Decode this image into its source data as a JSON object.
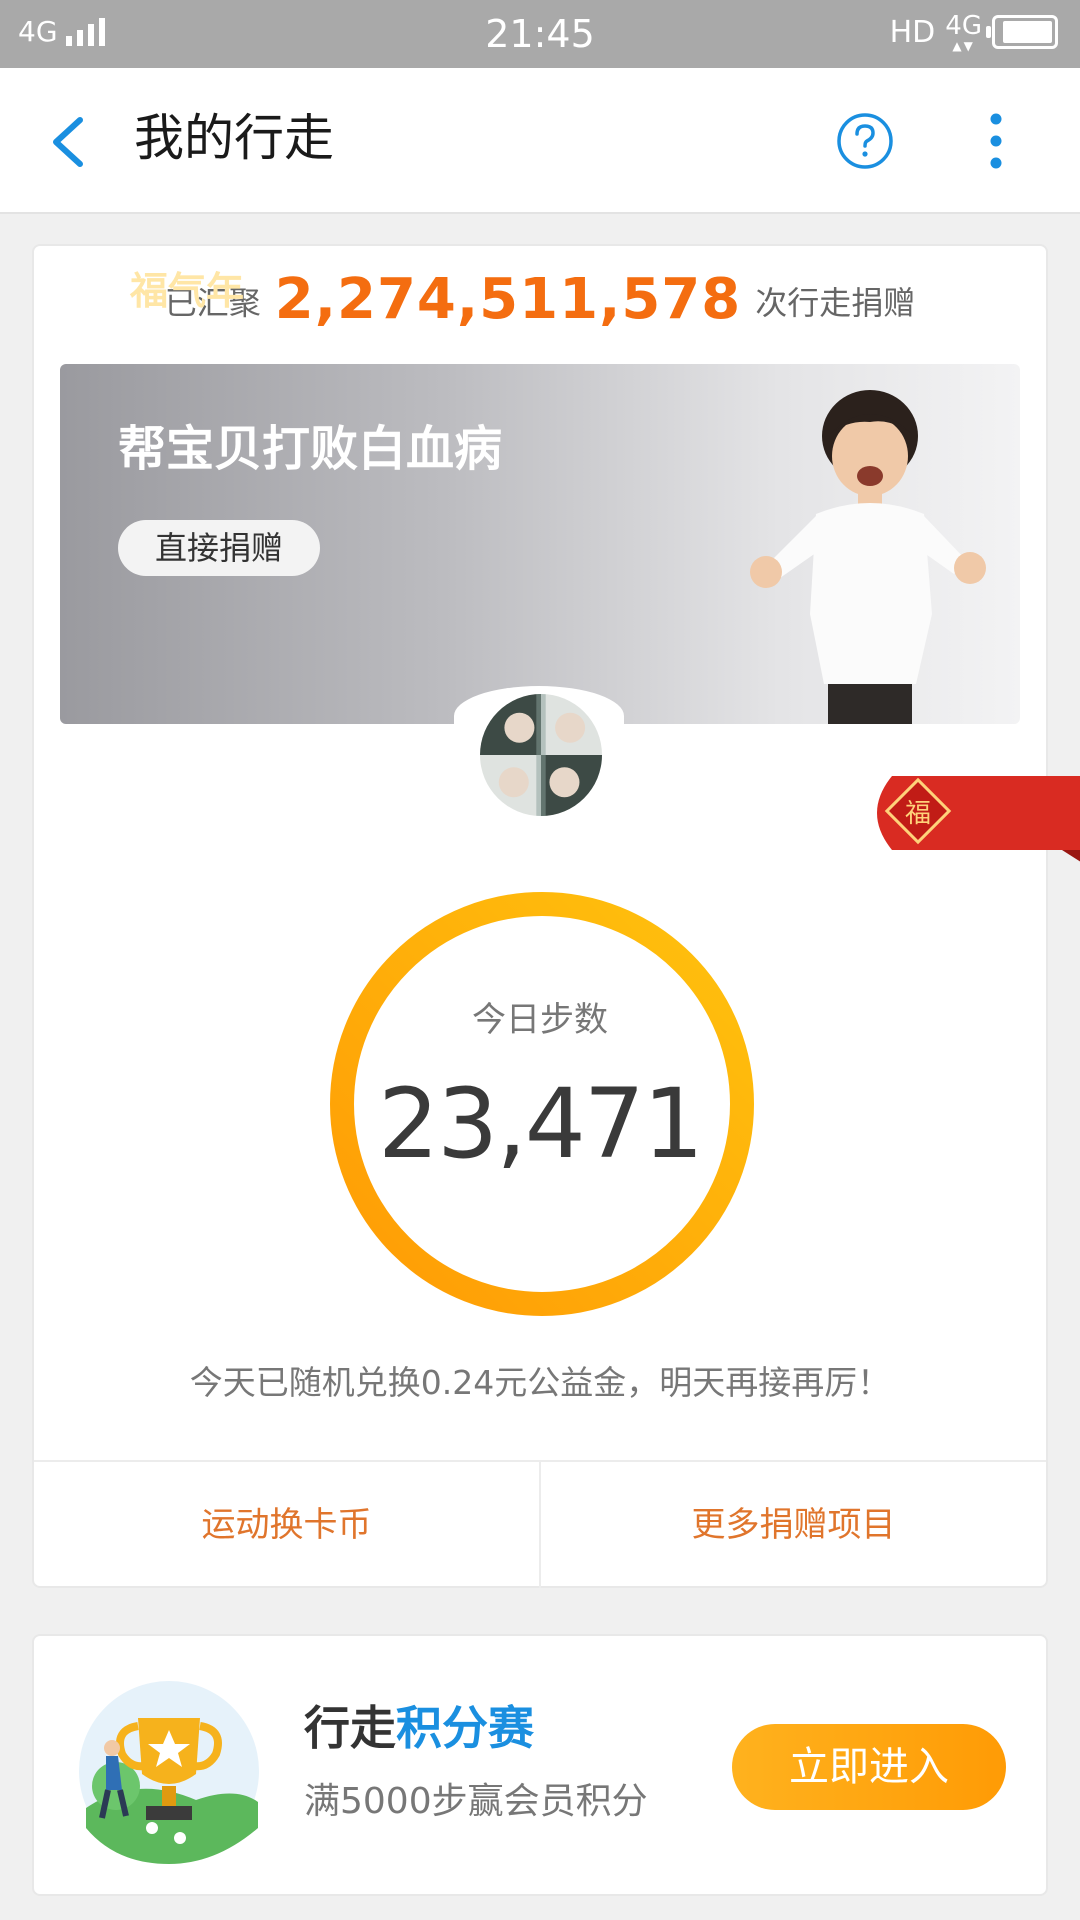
{
  "status_bar": {
    "network": "4G",
    "time": "21:45",
    "hd": "HD",
    "data_type": "4G",
    "battery_level": 0.9
  },
  "header": {
    "title": "我的行走",
    "icons": [
      "back-arrow-icon",
      "help-icon",
      "more-vertical-icon"
    ],
    "accent_color": "#1a8fe0"
  },
  "summary": {
    "prefix": "已汇聚",
    "count": "2,274,511,578",
    "suffix": "次行走捐赠",
    "count_color": "#f46d10"
  },
  "banner": {
    "title": "帮宝贝打败白血病",
    "button_label": "直接捐赠"
  },
  "festival_tag": {
    "text": "福气年",
    "icon": "fu-character-icon"
  },
  "steps": {
    "label": "今日步数",
    "value": "23,471",
    "ring_colors": [
      "#ff9b05",
      "#ffc20e"
    ]
  },
  "note": "今天已随机兑换0.24元公益金，明天再接再厉！",
  "actions": [
    {
      "label": "运动换卡币"
    },
    {
      "label": "更多捐赠项目"
    }
  ],
  "promo": {
    "title_part1": "行走",
    "title_part2": "积分赛",
    "subtitle": "满5000步赢会员积分",
    "button_label": "立即进入",
    "icon": "trophy-icon"
  }
}
